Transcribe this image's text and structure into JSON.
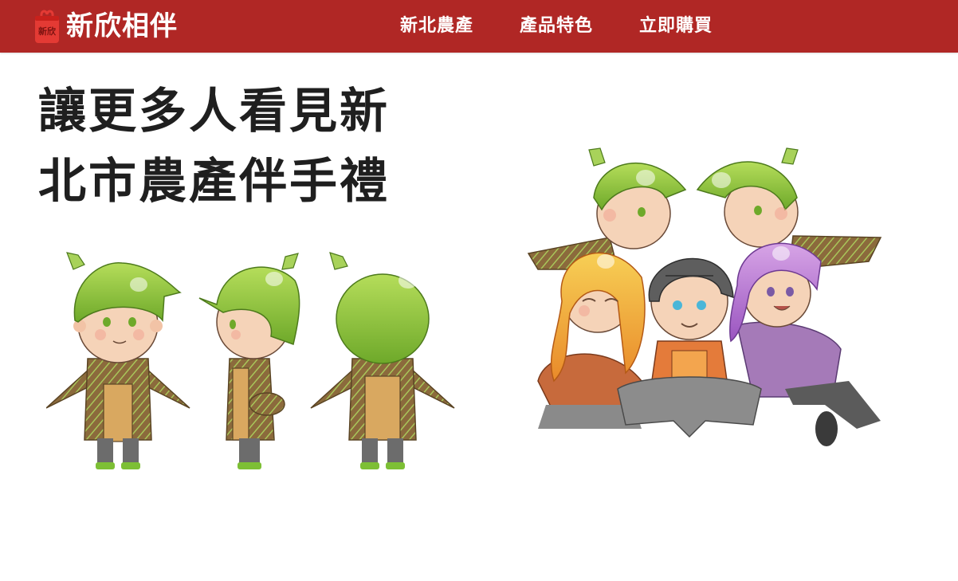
{
  "brand": {
    "name": "新欣相伴",
    "logo_text": "新欣",
    "logo_icon": "gift-bag-icon"
  },
  "nav": {
    "items": [
      {
        "label": "新北農產"
      },
      {
        "label": "產品特色"
      },
      {
        "label": "立即購買"
      }
    ]
  },
  "hero": {
    "title_lines": [
      "讓更多人看見新",
      "北市農產伴手禮"
    ]
  },
  "illustrations": {
    "mascot_turnaround": "bamboo-shoot-mascot-three-views",
    "mascot_group": "mascot-characters-group"
  },
  "colors": {
    "brand": "#b02725",
    "heading": "#1f1f1f",
    "mascot_green": "#8cc63f",
    "tunic_brown": "#8b6a3c",
    "apron_tan": "#d9a860"
  }
}
